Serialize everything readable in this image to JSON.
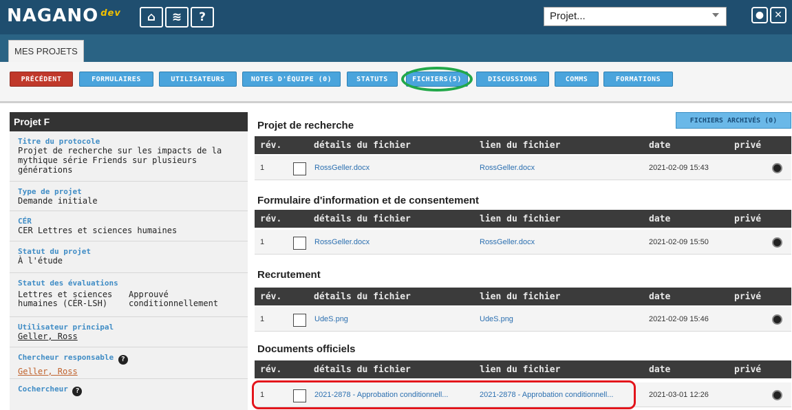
{
  "header": {
    "logo_text": "NAGANO",
    "logo_suffix": "dev",
    "project_select_value": "Projet...",
    "nav_icons": [
      "home-icon",
      "layers-icon",
      "help-icon"
    ],
    "right_icons": [
      "user-icon",
      "close-icon"
    ]
  },
  "tabs": {
    "mes_projets": "MES PROJETS"
  },
  "toolbar": {
    "buttons": [
      {
        "label": "PRÉCÉDENT"
      },
      {
        "label": "FORMULAIRES"
      },
      {
        "label": "UTILISATEURS"
      },
      {
        "label": "NOTES D'ÉQUIPE (0)"
      },
      {
        "label": "STATUTS"
      },
      {
        "label": "FICHIERS(5)"
      },
      {
        "label": "DISCUSSIONS"
      },
      {
        "label": "COMMS"
      },
      {
        "label": "FORMATIONS"
      }
    ]
  },
  "sidebar": {
    "title": "Projet F",
    "protocol_label": "Titre du protocole",
    "protocol_value": "Projet de recherche sur les impacts de la mythique série Friends sur plusieurs générations",
    "type_label": "Type de projet",
    "type_value": "Demande initiale",
    "cer_label": "CÉR",
    "cer_value": "CER Lettres et sciences humaines",
    "status_label": "Statut du projet",
    "status_value": "À l'étude",
    "eval_label": "Statut des évaluations",
    "eval_committee": "Lettres et sciences humaines (CÉR-LSH)",
    "eval_status": "Approuvé conditionnellement",
    "main_user_label": "Utilisateur principal",
    "main_user_value": "Geller, Ross",
    "responsible_label": "Chercheur responsable",
    "responsible_value": "Geller, Ross",
    "cochercheur_label": "Cochercheur"
  },
  "main": {
    "archive_button": "FICHIERS ARCHIVÉS (0)",
    "columns": {
      "rev": "rév.",
      "details": "détails du fichier",
      "link": "lien du fichier",
      "date": "date",
      "private": "privé"
    },
    "sections": [
      {
        "title": "Projet de recherche",
        "rev": "1",
        "details": "RossGeller.docx",
        "link": "RossGeller.docx",
        "date": "2021-02-09 15:43"
      },
      {
        "title": "Formulaire d'information et de consentement",
        "rev": "1",
        "details": "RossGeller.docx",
        "link": "RossGeller.docx",
        "date": "2021-02-09 15:50"
      },
      {
        "title": "Recrutement",
        "rev": "1",
        "details": "UdeS.png",
        "link": "UdeS.png",
        "date": "2021-02-09 15:46"
      },
      {
        "title": "Documents officiels",
        "rev": "1",
        "details": "2021-2878 - Approbation conditionnell...",
        "link": "2021-2878 - Approbation conditionnell...",
        "date": "2021-03-01 12:26"
      }
    ]
  },
  "colors": {
    "accent": "#4aa4dc",
    "header": "#1f4e6f",
    "highlight_red": "#e3141b",
    "highlight_green": "#22a84a"
  }
}
